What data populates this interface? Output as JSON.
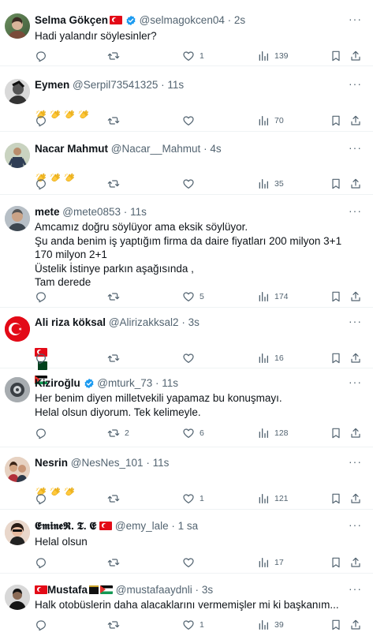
{
  "icons": {
    "reply": "reply-icon",
    "retweet": "retweet-icon",
    "like": "heart-icon",
    "views": "views-icon",
    "bookmark": "bookmark-icon",
    "share": "share-icon",
    "more": "more-icon"
  },
  "colors": {
    "verified": "#1d9bf0",
    "muted": "#536471",
    "text": "#0f1419"
  },
  "tweets": [
    {
      "name": "Selma Gökçen",
      "handle": "@selmagokcen04",
      "time": "2s",
      "text": "Hadi yalandır söylesinler?",
      "counts": {
        "reply": "",
        "retweet": "",
        "like": "1",
        "views": "139"
      }
    },
    {
      "name": "Eymen",
      "handle": "@Serpil73541325",
      "time": "11s",
      "text": "",
      "counts": {
        "reply": "",
        "retweet": "",
        "like": "",
        "views": "70"
      }
    },
    {
      "name": "Nacar Mahmut",
      "handle": "@Nacar__Mahmut",
      "time": "4s",
      "text": "",
      "counts": {
        "reply": "",
        "retweet": "",
        "like": "",
        "views": "35"
      }
    },
    {
      "name": "mete",
      "handle": "@mete0853",
      "time": "11s",
      "text": "Amcamız doğru söylüyor ama eksik söylüyor.\nŞu anda benim iş yaptığım firma da daire fiyatları 200 milyon 3+1\n170 milyon 2+1\nÜstelik İstinye parkın aşağısında ,\nTam derede",
      "counts": {
        "reply": "",
        "retweet": "",
        "like": "5",
        "views": "174"
      }
    },
    {
      "name": "Ali riza köksal",
      "handle": "@Alirizakksal2",
      "time": "3s",
      "text": "",
      "counts": {
        "reply": "",
        "retweet": "",
        "like": "",
        "views": "16"
      }
    },
    {
      "name": "Kiziroğlu",
      "handle": "@mturk_73",
      "time": "11s",
      "text": "Her benim diyen milletvekili yapamaz bu konuşmayı.\nHelal olsun diyorum. Tek kelimeyle.",
      "counts": {
        "reply": "",
        "retweet": "2",
        "like": "6",
        "views": "128"
      }
    },
    {
      "name": "Nesrin",
      "handle": "@NesNes_101",
      "time": "11s",
      "text": "",
      "counts": {
        "reply": "",
        "retweet": "",
        "like": "1",
        "views": "121"
      }
    },
    {
      "name": "𝕰𝖒𝖎𝖓𝖊𝕽. 𝕿. 𝕰",
      "handle": "@emy_lale",
      "time": "1 sa",
      "text": "Helal olsun",
      "counts": {
        "reply": "",
        "retweet": "",
        "like": "",
        "views": "17"
      }
    },
    {
      "name": "Mustafa",
      "handle": "@mustafaaydnli",
      "time": "3s",
      "text": "Halk otobüslerin daha alacaklarını vermemişler mi ki başkanım...",
      "counts": {
        "reply": "",
        "retweet": "",
        "like": "1",
        "views": "39"
      }
    }
  ]
}
